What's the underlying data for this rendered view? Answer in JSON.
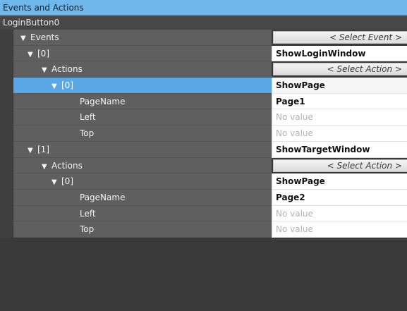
{
  "panel": {
    "title": "Events and Actions",
    "object_name": "LoginButton0"
  },
  "colors": {
    "title_bar": "#6fb8ec",
    "row_bg": "#5f5f5f",
    "selected_row": "#5aa9e6",
    "value_bg": "#ffffff"
  },
  "icons": {
    "expander": "triangle-down-icon"
  },
  "rows": [
    {
      "caret": "▼",
      "label": "Events",
      "select": "< Select Event >"
    },
    {
      "caret": "▼",
      "label": "[0]",
      "value": "ShowLoginWindow"
    },
    {
      "caret": "▼",
      "label": "Actions",
      "select": "< Select Action >"
    },
    {
      "caret": "▼",
      "label": "[0]",
      "value": "ShowPage",
      "selected": true
    },
    {
      "label": "PageName",
      "value": "Page1"
    },
    {
      "label": "Left",
      "value": "No value"
    },
    {
      "label": "Top",
      "value": "No value"
    },
    {
      "caret": "▼",
      "label": "[1]",
      "value": "ShowTargetWindow"
    },
    {
      "caret": "▼",
      "label": "Actions",
      "select": "< Select Action >"
    },
    {
      "caret": "▼",
      "label": "[0]",
      "value": "ShowPage"
    },
    {
      "label": "PageName",
      "value": "Page2"
    },
    {
      "label": "Left",
      "value": "No value"
    },
    {
      "label": "Top",
      "value": "No value"
    }
  ]
}
